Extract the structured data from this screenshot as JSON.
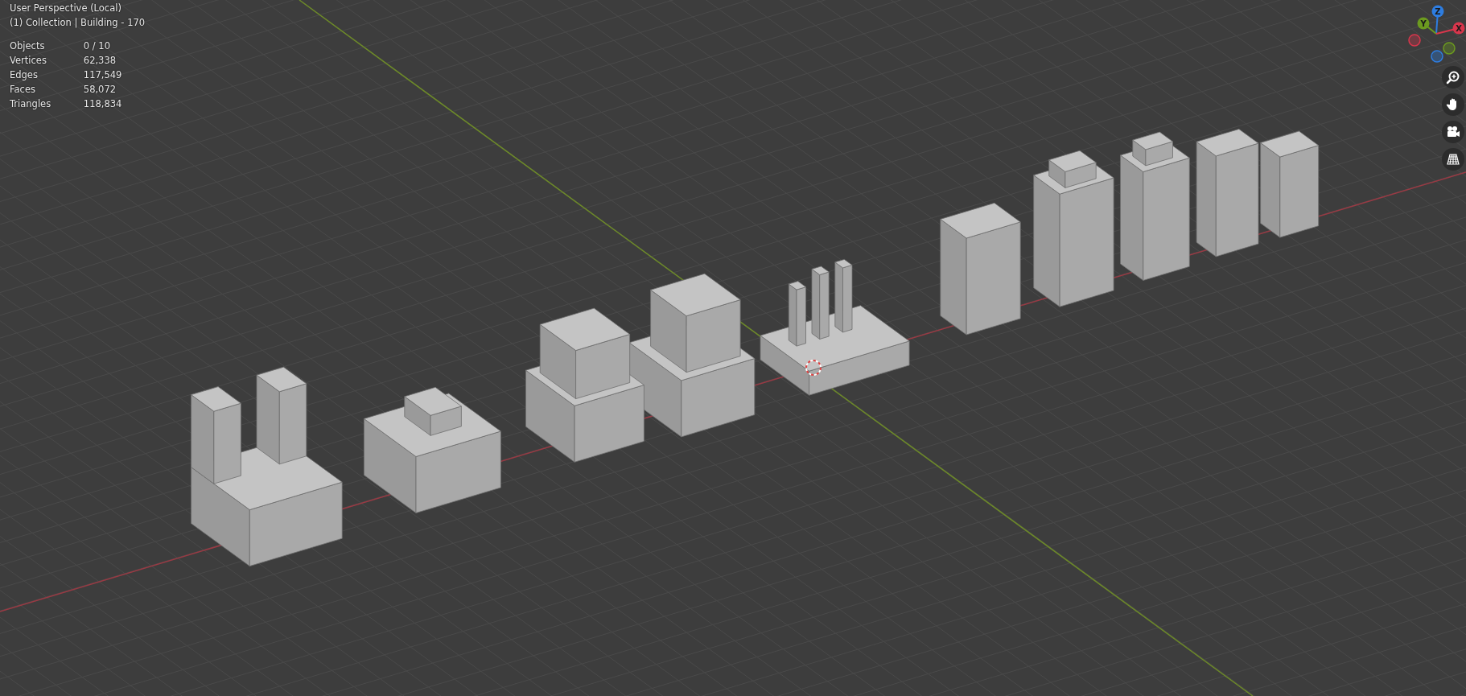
{
  "viewport": {
    "view_name": "User Perspective (Local)",
    "collection_line": "(1) Collection | Building - 170",
    "stats": [
      {
        "label": "Objects",
        "value": "0 / 10"
      },
      {
        "label": "Vertices",
        "value": "62,338"
      },
      {
        "label": "Edges",
        "value": "117,549"
      },
      {
        "label": "Faces",
        "value": "58,072"
      },
      {
        "label": "Triangles",
        "value": "118,834"
      }
    ]
  },
  "gizmo": {
    "axes": [
      {
        "label": "Z",
        "color": "#2e7de0"
      },
      {
        "label": "Y",
        "color": "#6c9a1f"
      },
      {
        "label": "X",
        "color": "#d8364c"
      }
    ]
  }
}
